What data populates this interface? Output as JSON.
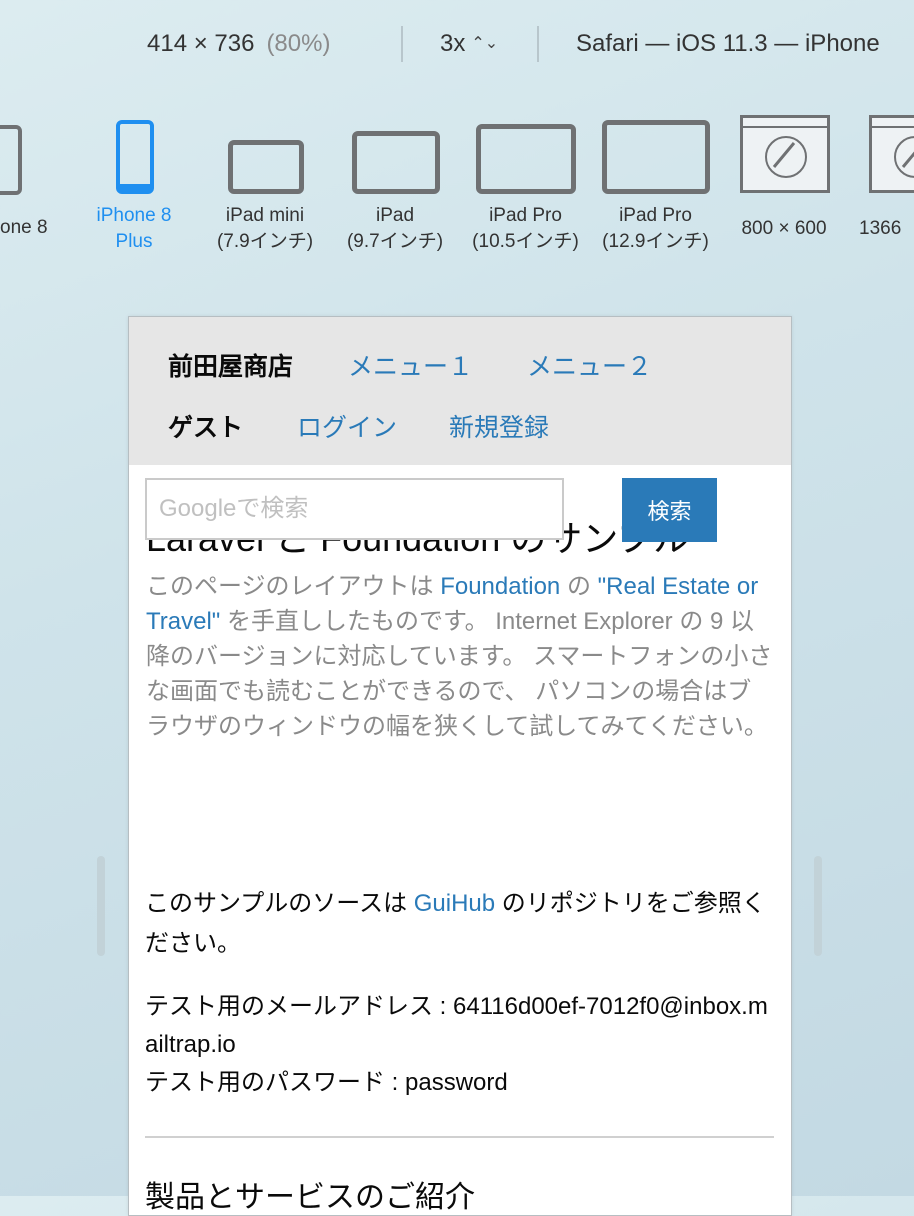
{
  "toolbar": {
    "dimensions": "414 × 736",
    "zoom": "(80%)",
    "scale": "3x",
    "browser": "Safari — iOS 11.3 — iPhone"
  },
  "devices": [
    {
      "line1": "one 8",
      "line2": ""
    },
    {
      "line1": "iPhone 8",
      "line2": "Plus",
      "selected": true
    },
    {
      "line1": "iPad mini",
      "line2": "(7.9インチ)"
    },
    {
      "line1": "iPad",
      "line2": "(9.7インチ)"
    },
    {
      "line1": "iPad Pro",
      "line2": "(10.5インチ)"
    },
    {
      "line1": "iPad Pro",
      "line2": "(12.9インチ)"
    },
    {
      "line1": "800 × 600",
      "line2": ""
    },
    {
      "line1": "1366",
      "line2": ""
    }
  ],
  "site": {
    "nav": {
      "brand": "前田屋商店",
      "menu1": "メニュー１",
      "menu2": "メニュー２",
      "user": "ゲスト",
      "login": "ログイン",
      "register": "新規登録"
    },
    "heading": "Laravel と Foundation のサンプル",
    "intro": {
      "part1": "このページのレイアウトは ",
      "link1": "Foundation",
      "part2": " の ",
      "link2": "\"Real Estate or Travel\"",
      "part3": " を手直ししたものです。 Internet Explorer の 9 以降のバージョンに対応しています。 スマートフォンの小さな画面でも読むことができるので、 パソコンの場合はブラウザのウィンドウの幅を狭くして試してみてください。"
    },
    "search": {
      "placeholder": "Googleで検索",
      "button": "検索"
    },
    "source": {
      "part1": "このサンプルのソースは ",
      "link": "GuiHub",
      "part2": " のリポジトリをご参照ください。"
    },
    "credentials": {
      "email_label": "テスト用のメールアドレス : ",
      "email": "64116d00ef-7012f0@inbox.mailtrap.io",
      "password_label": "テスト用のパスワード : ",
      "password": "password"
    },
    "next_heading": "製品とサービスのご紹介"
  }
}
